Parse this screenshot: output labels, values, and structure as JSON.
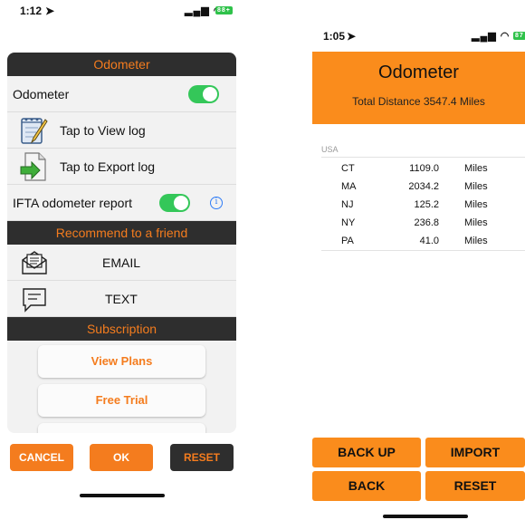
{
  "left": {
    "status": {
      "time": "1:12",
      "signal": "▂▄▆ ◠",
      "battery": "88+"
    },
    "odometer_header": "Odometer",
    "odometer_toggle_label": "Odometer",
    "view_log_label": "Tap to View log",
    "export_log_label": "Tap to Export log",
    "ifta_label": "IFTA odometer report",
    "info_glyph": "i",
    "recommend_header": "Recommend to a friend",
    "email_label": "EMAIL",
    "text_label": "TEXT",
    "subscription_header": "Subscription",
    "view_plans_label": "View Plans",
    "free_trial_label": "Free Trial",
    "cancel_label": "CANCEL",
    "ok_label": "OK",
    "reset_label": "RESET",
    "toggles": {
      "odometer": true,
      "ifta": true
    }
  },
  "right": {
    "status": {
      "time": "1:05",
      "signal": "▂▄▆ ◠",
      "battery": "87"
    },
    "title": "Odometer",
    "subtitle": "Total Distance 3547.4 Miles",
    "section": "USA",
    "rows": [
      {
        "state": "CT",
        "value": "1109.0",
        "unit": "Miles"
      },
      {
        "state": "MA",
        "value": "2034.2",
        "unit": "Miles"
      },
      {
        "state": "NJ",
        "value": "125.2",
        "unit": "Miles"
      },
      {
        "state": "NY",
        "value": "236.8",
        "unit": "Miles"
      },
      {
        "state": "PA",
        "value": "41.0",
        "unit": "Miles"
      }
    ],
    "backup_label": "BACK UP",
    "import_label": "IMPORT",
    "back_label": "BACK",
    "reset_label": "RESET"
  },
  "colors": {
    "accent": "#f47c1e",
    "header_orange": "#fa8c1c",
    "dark_band": "#2e2e2e",
    "toggle_on": "#34c759",
    "info_blue": "#2f7cf6"
  },
  "icons": {
    "notepad": "notepad-pencil-icon",
    "export": "export-document-icon",
    "email": "envelope-letter-icon",
    "text": "chat-bubble-icon",
    "location": "location-arrow-icon"
  }
}
